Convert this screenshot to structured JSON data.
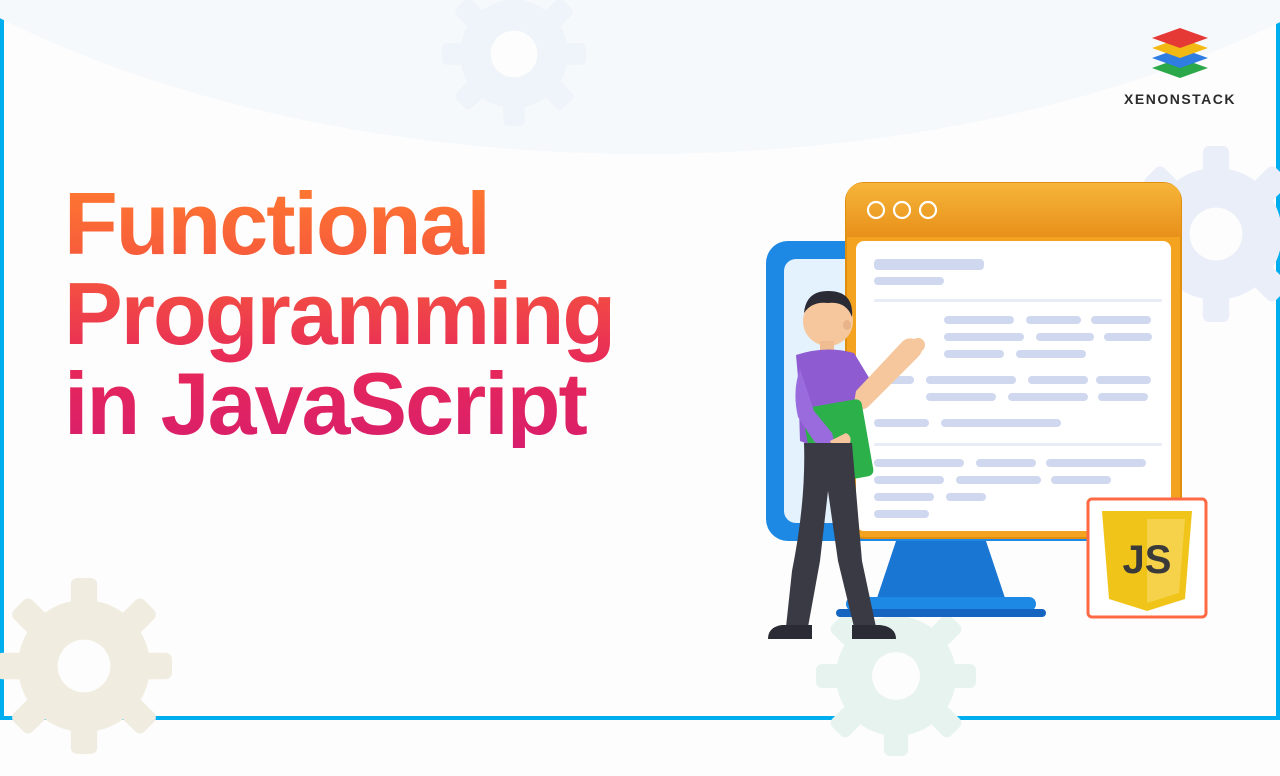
{
  "headline": "Functional\nProgramming\nin JavaScript",
  "logo": {
    "text": "XENONSTACK"
  },
  "js_label": "JS"
}
